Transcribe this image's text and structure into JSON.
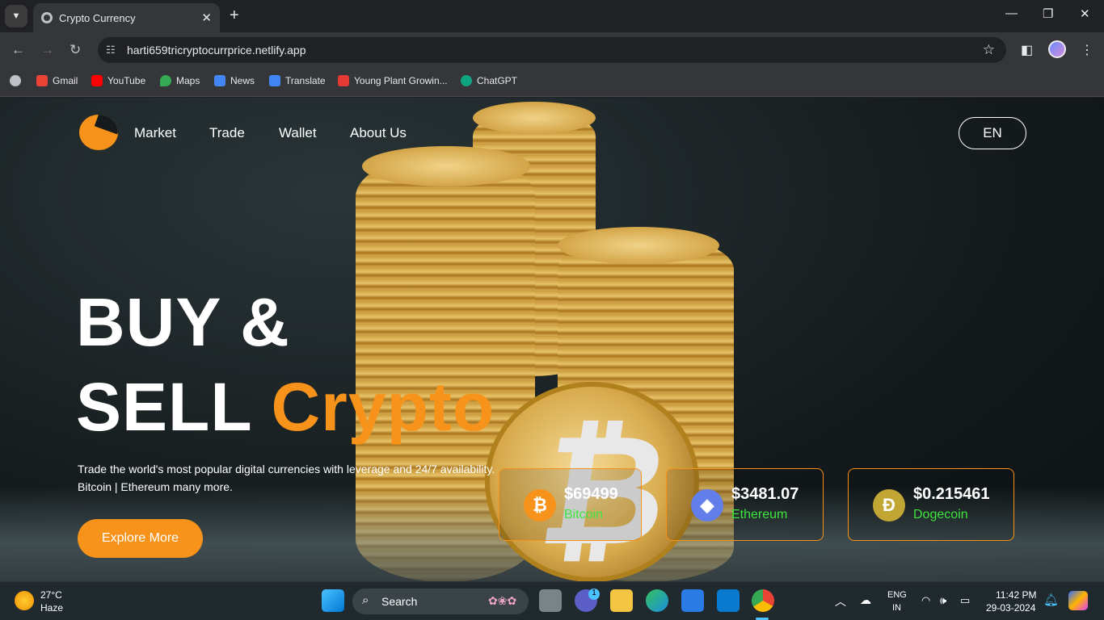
{
  "browser": {
    "tab_title": "Crypto Currency",
    "tab_close": "✕",
    "new_tab": "+",
    "url": "harti659tricryptocurrprice.netlify.app",
    "bookmarks": [
      "Gmail",
      "YouTube",
      "Maps",
      "News",
      "Translate",
      "Young Plant Growin...",
      "ChatGPT"
    ]
  },
  "site": {
    "nav": [
      "Market",
      "Trade",
      "Wallet",
      "About Us"
    ],
    "lang_button": "EN",
    "hero_line1": "BUY &",
    "hero_line2_white": "SELL",
    "hero_line2_accent": "Crypto",
    "tagline_line1": "Trade the world's most popular digital currencies with leverage and 24/7 availability.",
    "tagline_line2": "Bitcoin | Ethereum many more.",
    "explore_button": "Explore More",
    "accent_color": "#f7931a",
    "name_color": "#3ee53e",
    "coins": [
      {
        "price": "$69499",
        "name": "Bitcoin",
        "icon": "bitcoin-icon",
        "glyph": "₿",
        "color": "#f7931a"
      },
      {
        "price": "$3481.07",
        "name": "Ethereum",
        "icon": "ethereum-icon",
        "glyph": "◆",
        "color": "#627eea"
      },
      {
        "price": "$0.215461",
        "name": "Dogecoin",
        "icon": "dogecoin-icon",
        "glyph": "Ð",
        "color": "#c2a633"
      }
    ]
  },
  "taskbar": {
    "temperature": "27°C",
    "weather": "Haze",
    "search_label": "Search",
    "lang_line1": "ENG",
    "lang_line2": "IN",
    "time": "11:42 PM",
    "date": "29-03-2024",
    "chat_badge": "1"
  }
}
